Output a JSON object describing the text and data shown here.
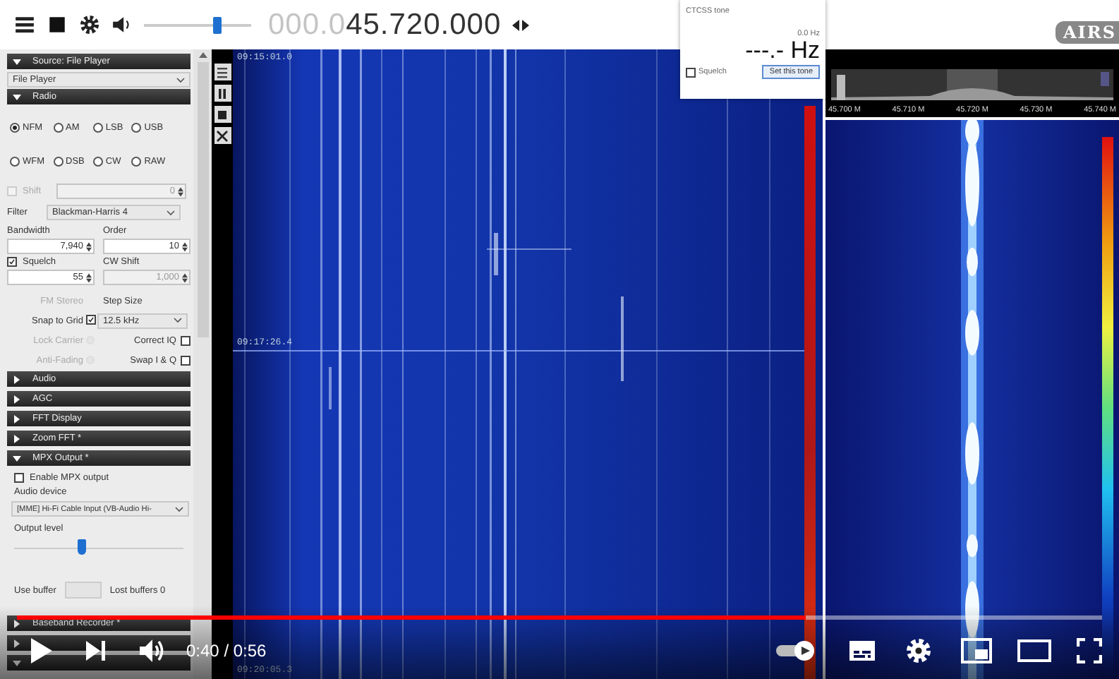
{
  "toolbar": {
    "frequency_prefix": "000.0",
    "frequency": "45.720.000",
    "volume": {
      "level": 0.68
    }
  },
  "logo": "AIRS",
  "ctcss": {
    "title": "CTCSS tone",
    "reading": "0.0 Hz",
    "tone": "---.- Hz",
    "squelch": {
      "label": "Squelch",
      "checked": false
    },
    "button": "Set this tone"
  },
  "source": {
    "header": "Source: File Player",
    "expanded": true,
    "value": "File Player"
  },
  "radio": {
    "header": "Radio",
    "expanded": true,
    "modes": [
      {
        "label": "NFM",
        "selected": true
      },
      {
        "label": "AM",
        "selected": false
      },
      {
        "label": "LSB",
        "selected": false
      },
      {
        "label": "USB",
        "selected": false
      },
      {
        "label": "WFM",
        "selected": false
      },
      {
        "label": "DSB",
        "selected": false
      },
      {
        "label": "CW",
        "selected": false
      },
      {
        "label": "RAW",
        "selected": false
      }
    ],
    "shift": {
      "label": "Shift",
      "checked": false,
      "disabled": true,
      "value": "0"
    },
    "filter": {
      "label": "Filter",
      "value": "Blackman-Harris 4"
    },
    "bandwidth": {
      "label": "Bandwidth",
      "value": "7,940"
    },
    "order": {
      "label": "Order",
      "value": "10"
    },
    "squelch": {
      "label": "Squelch",
      "checked": true,
      "value": "55"
    },
    "cw_shift": {
      "label": "CW Shift",
      "value": "1,000",
      "disabled": true
    },
    "fm_stereo": {
      "label": "FM Stereo",
      "disabled": true
    },
    "step_size": {
      "label": "Step Size"
    },
    "snap": {
      "label": "Snap to Grid",
      "checked": true,
      "value": "12.5 kHz"
    },
    "lock_carrier": {
      "label": "Lock Carrier",
      "disabled": true
    },
    "correct_iq": {
      "label": "Correct IQ",
      "checked": false
    },
    "anti_fading": {
      "label": "Anti-Fading",
      "disabled": true
    },
    "swap_iq": {
      "label": "Swap I & Q",
      "checked": false
    }
  },
  "sections": [
    {
      "label": "Audio",
      "expanded": false
    },
    {
      "label": "AGC",
      "expanded": false
    },
    {
      "label": "FFT Display",
      "expanded": false
    },
    {
      "label": "Zoom FFT *",
      "expanded": false
    },
    {
      "label": "MPX Output *",
      "expanded": true
    }
  ],
  "mpx": {
    "enable": {
      "label": "Enable MPX output",
      "checked": false
    },
    "device_label": "Audio device",
    "device": "[MME] Hi-Fi Cable Input (VB-Audio Hi-",
    "output_label": "Output level",
    "output": {
      "level": 0.4
    },
    "buffer_label": "Use buffer",
    "lost_buffers": "Lost buffers 0"
  },
  "lower_sections": [
    {
      "label": "Baseband Recorder *",
      "expanded": false
    },
    {
      "expanded": false
    },
    {
      "expanded": true
    }
  ],
  "waterfall": {
    "timestamps": [
      "09:15:01.0",
      "09:17:26.4",
      "09:20:05.3"
    ]
  },
  "spectrum": {
    "labels": [
      "45.700 M",
      "45.710 M",
      "45.720 M",
      "45.730 M",
      "45.740 M"
    ]
  },
  "player": {
    "progress": {
      "level": 0.727
    },
    "time": "0:40 / 0:56",
    "autoplay": {
      "on": true
    }
  }
}
